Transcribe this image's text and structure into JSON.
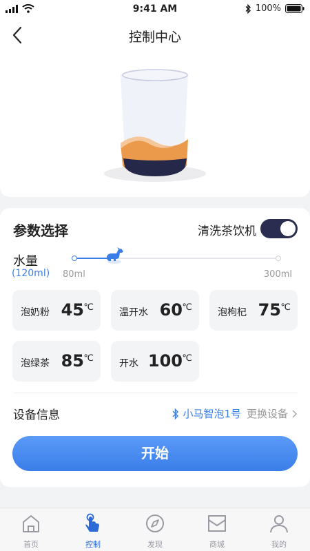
{
  "status_bar": {
    "time": "9:41 AM",
    "battery": "100%"
  },
  "header": {
    "title": "控制中心"
  },
  "params": {
    "title": "参数选择",
    "clean_label": "清洗茶饮机",
    "clean_on": true,
    "water_label": "水量",
    "water_value": "(120ml)",
    "water_min": "80ml",
    "water_max": "300ml",
    "water_level": 0.18
  },
  "temps": [
    {
      "name": "泡奶粉",
      "value": "45",
      "unit": "℃"
    },
    {
      "name": "温开水",
      "value": "60",
      "unit": "℃"
    },
    {
      "name": "泡枸杞",
      "value": "75",
      "unit": "℃"
    },
    {
      "name": "泡绿茶",
      "value": "85",
      "unit": "℃"
    },
    {
      "name": "开水",
      "value": "100",
      "unit": "℃"
    }
  ],
  "device": {
    "label": "设备信息",
    "name": "小马智泡1号",
    "change": "更换设备"
  },
  "start_button": "开始",
  "tabs": [
    {
      "label": "首页",
      "icon": "home-icon"
    },
    {
      "label": "控制",
      "icon": "tap-hand-icon"
    },
    {
      "label": "发现",
      "icon": "compass-icon"
    },
    {
      "label": "商城",
      "icon": "mall-icon"
    },
    {
      "label": "我的",
      "icon": "profile-icon"
    }
  ],
  "colors": {
    "accent": "#3a7ee8",
    "toggle": "#2a2d4f",
    "drink": "#ea9a4a"
  }
}
